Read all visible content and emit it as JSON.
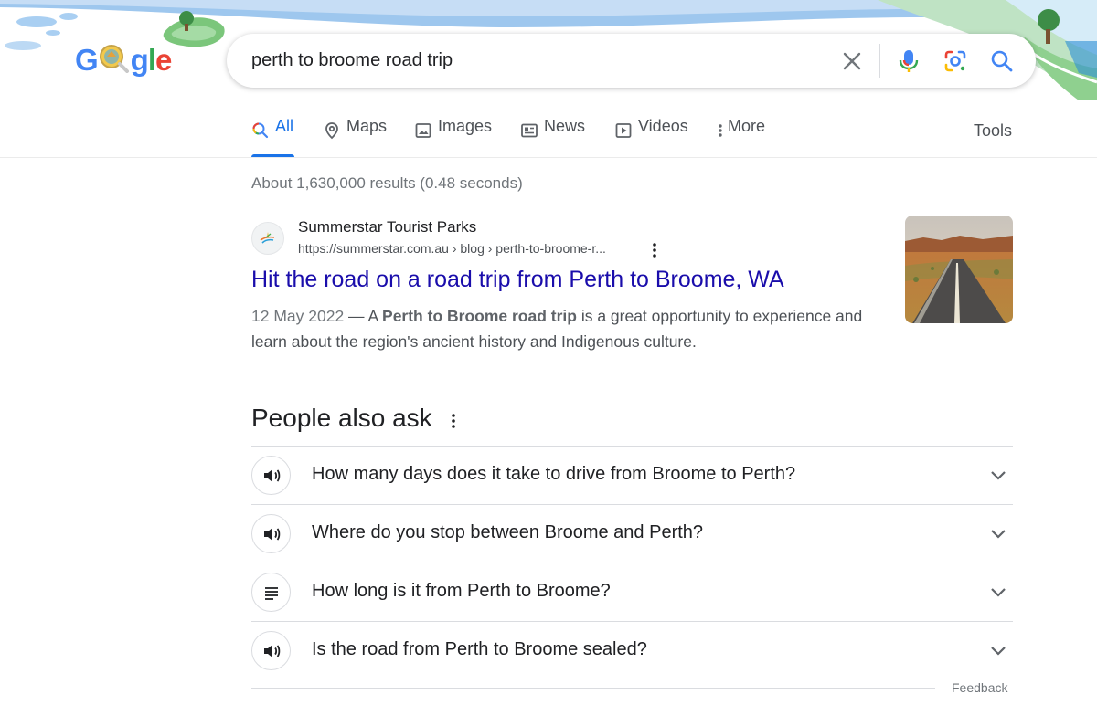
{
  "search": {
    "query": "perth to broome road trip"
  },
  "logo": {
    "letters": [
      "G",
      "o",
      "o",
      "g",
      "l",
      "e"
    ]
  },
  "tabs": [
    {
      "label": "All",
      "icon": "search-icon",
      "active": true
    },
    {
      "label": "Maps",
      "icon": "map-pin-icon",
      "active": false
    },
    {
      "label": "Images",
      "icon": "image-icon",
      "active": false
    },
    {
      "label": "News",
      "icon": "news-icon",
      "active": false
    },
    {
      "label": "Videos",
      "icon": "video-icon",
      "active": false
    },
    {
      "label": "More",
      "icon": "more-vert-icon",
      "active": false
    }
  ],
  "tools_label": "Tools",
  "stats": "About 1,630,000 results (0.48 seconds)",
  "result": {
    "site_name": "Summerstar Tourist Parks",
    "url": "https://summerstar.com.au › blog › perth-to-broome-r...",
    "title": "Hit the road on a road trip from Perth to Broome, WA",
    "date": "12 May 2022",
    "snippet_pre": " — A ",
    "snippet_bold": "Perth to Broome road trip",
    "snippet_post": " is a great opportunity to experience and learn about the region's ancient history and Indigenous culture."
  },
  "people_also_ask": {
    "title": "People also ask",
    "questions": [
      {
        "text": "How many days does it take to drive from Broome to Perth?",
        "icon": "speaker-icon"
      },
      {
        "text": "Where do you stop between Broome and Perth?",
        "icon": "speaker-icon"
      },
      {
        "text": "How long is it from Perth to Broome?",
        "icon": "list-icon"
      },
      {
        "text": "Is the road from Perth to Broome sealed?",
        "icon": "speaker-icon"
      }
    ]
  },
  "feedback_label": "Feedback",
  "colors": {
    "link": "#1a0dab",
    "accent": "#1a73e8",
    "text": "#202124",
    "muted": "#70757a"
  }
}
